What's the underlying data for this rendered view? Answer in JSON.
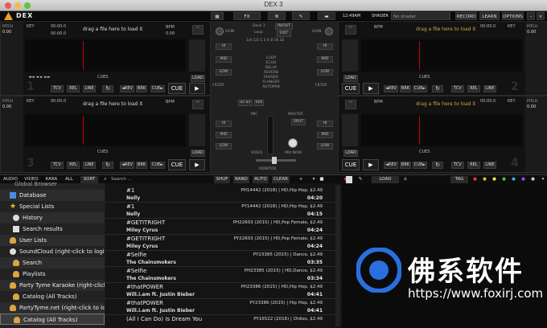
{
  "window": {
    "title": "DEX 3"
  },
  "topbar": {
    "logo": "DEX",
    "fx": "FX",
    "clock": "12:49AM",
    "shader_label": "SHADER",
    "shader_value": "No shader",
    "record": "RECORD",
    "learn": "LEARN",
    "options": "OPTIONS"
  },
  "deck": {
    "pitch": "PITCH",
    "key": "KEY",
    "bpm": "BPM",
    "time": "00:00.0",
    "zero": "0",
    "zero2": "0.00",
    "hint": "drag a file here to load it",
    "tcv": "TCV",
    "rel": "REL",
    "line": "LINE",
    "cue": "CUE",
    "rev": "◄REV",
    "brk": "BRK",
    "cuebtn": "CUE►",
    "cues": "CUES",
    "in": "IN",
    "out": "OUT",
    "load": "LOAD",
    "match": "MATCH",
    "sync": "SYNC",
    "pct": "0%",
    "loops": [
      "1",
      "2",
      "4",
      "8",
      "16",
      "32"
    ]
  },
  "mixer": {
    "deck1": "Deck 1",
    "loop": "Loop",
    "inout": "IN/OUT",
    "exit": "EXIT",
    "fx": [
      "LOOP",
      "ECHO",
      "DELAY",
      "REVERB",
      "PHASER",
      "FLANGER",
      "AUTOPAN"
    ],
    "gain": "GAIN",
    "hi": "HI",
    "mid": "MID",
    "low": "LOW",
    "filter": "FILTER",
    "onair": "on air",
    "talk": "talk",
    "mic": "MIC",
    "master": "MASTER",
    "split": "SPLIT",
    "mixnow": "MIX NOW",
    "video": "VIDEO",
    "monitor": "MONITOR"
  },
  "browser": {
    "tabs": [
      "AUDIO",
      "VIDEO",
      "KARA",
      "ALL",
      "SORT"
    ],
    "search_placeholder": "Search ...",
    "actions": [
      "SHUF",
      "RAND",
      "AUTO",
      "CLEAR"
    ],
    "load_singer": "LOAD SINGER",
    "tag": "TAG"
  },
  "tree": [
    "Global Browser",
    "Database",
    "Special Lists",
    "History",
    "Search results",
    "User Lists",
    "SoundCloud (right-click to login)",
    "Search",
    "Playlists",
    "Party Tyme Karaoke (right-click t",
    "Catalog (All Tracks)",
    "PartyTyme.net (right-click to login",
    "Catalog (All Tracks)"
  ],
  "tracks": [
    {
      "title": "#1",
      "artist": "Nelly",
      "info": "PH14442 (2018) | HD,Hip Hop, $2.49",
      "dur": "04:20"
    },
    {
      "title": "#1",
      "artist": "Nelly",
      "info": "PY14442 (2018) | HD,Hip Hop, $2.49",
      "dur": "04:15"
    },
    {
      "title": "#GETITRIGHT",
      "artist": "Miley Cyrus",
      "info": "PH22603 (2015) | HD,Pop Female, $2.49",
      "dur": "04:24"
    },
    {
      "title": "#GETITRIGHT",
      "artist": "Miley Cyrus",
      "info": "PY22603 (2015) | HD,Pop Female, $2.49",
      "dur": "04:24"
    },
    {
      "title": "#Selfie",
      "artist": "The Chainsmokers",
      "info": "PY23385 (2015) | Dance, $2.49",
      "dur": "03:35"
    },
    {
      "title": "#Selfie",
      "artist": "The Chainsmokers",
      "info": "PH23385 (2015) | HD,Dance, $2.49",
      "dur": "03:34"
    },
    {
      "title": "#thatPOWER",
      "artist": "Will.i.am ft. Justin Bieber",
      "info": "PH23386 (2015) | HD,Hip Hop, $2.49",
      "dur": "04:41"
    },
    {
      "title": "#thatPOWER",
      "artist": "Will.i.am ft. Justin Bieber",
      "info": "PY23386 (2015) | Hip Hop, $2.49",
      "dur": "04:41"
    },
    {
      "title": "(All I Can Do) Is Dream You",
      "artist": "",
      "info": "PY16522 (2016) | Oldies, $2.49",
      "dur": ""
    }
  ],
  "watermark": {
    "cn": "佛系软件",
    "url": "https://www.foxirj.com"
  }
}
